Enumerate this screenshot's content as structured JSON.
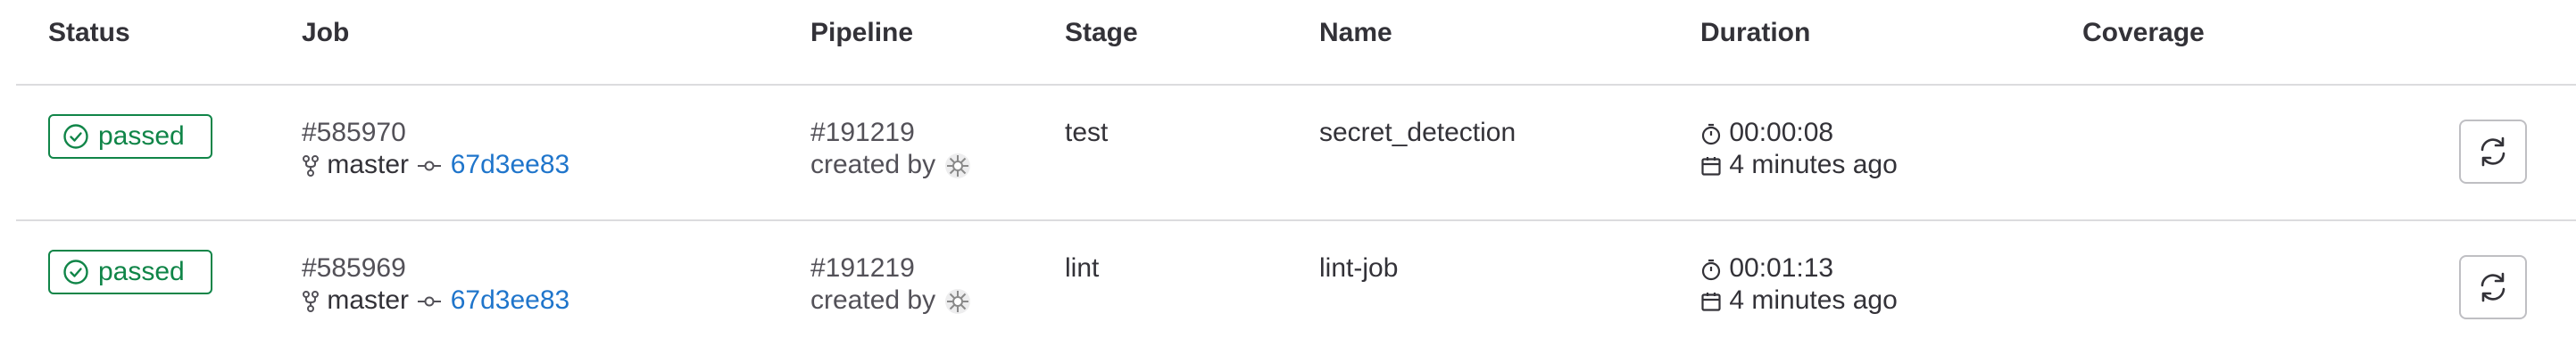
{
  "columns": {
    "status": "Status",
    "job": "Job",
    "pipeline": "Pipeline",
    "stage": "Stage",
    "name": "Name",
    "duration": "Duration",
    "coverage": "Coverage"
  },
  "rows": [
    {
      "status": "passed",
      "job_id": "#585970",
      "branch": "master",
      "commit": "67d3ee83",
      "pipeline_id": "#191219",
      "created_by": "created by",
      "stage": "test",
      "name": "secret_detection",
      "duration": "00:00:08",
      "finished": "4 minutes ago"
    },
    {
      "status": "passed",
      "job_id": "#585969",
      "branch": "master",
      "commit": "67d3ee83",
      "pipeline_id": "#191219",
      "created_by": "created by",
      "stage": "lint",
      "name": "lint-job",
      "duration": "00:01:13",
      "finished": "4 minutes ago"
    }
  ],
  "icons": {
    "status": "check-circle-icon",
    "branch": "branch-icon",
    "commit": "commit-icon",
    "user": "avatar-icon",
    "timer": "timer-icon",
    "calendar": "calendar-icon",
    "retry": "retry-icon"
  },
  "colors": {
    "success": "#108548",
    "link": "#1f75cb",
    "text": "#333238",
    "border": "#dcdcde"
  }
}
